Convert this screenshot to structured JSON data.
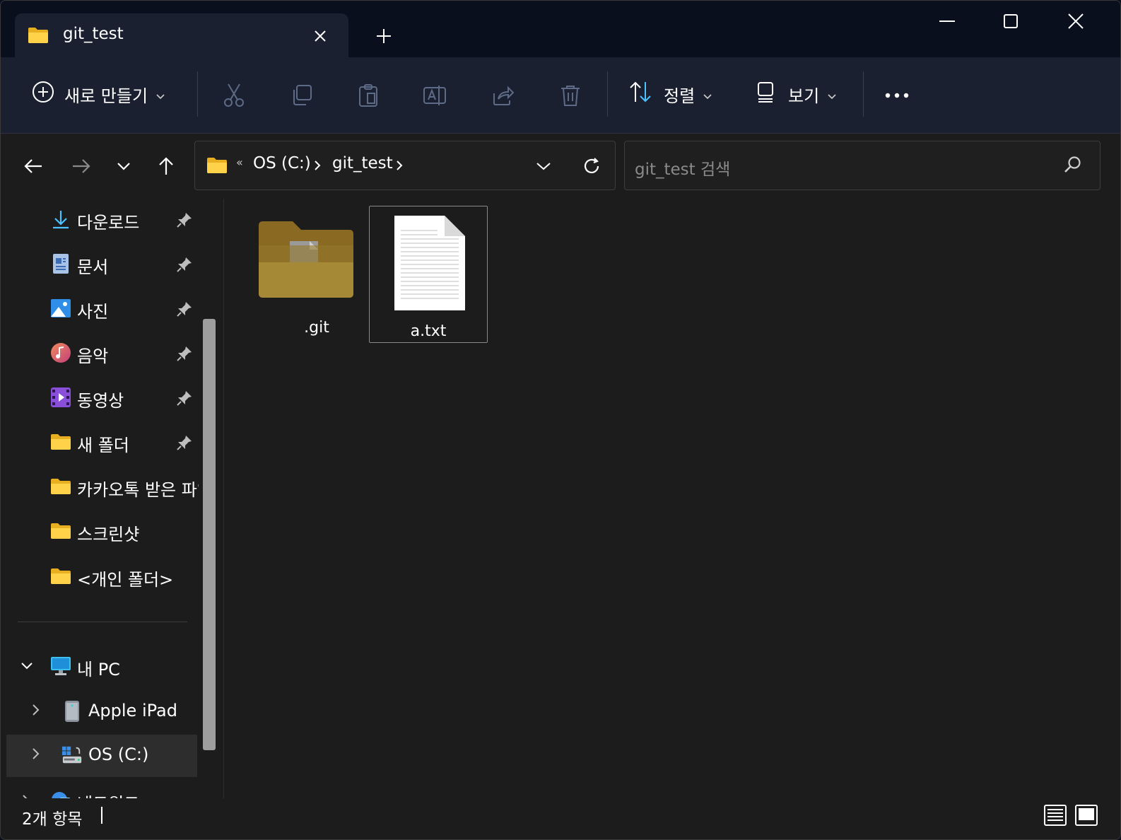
{
  "window": {
    "tab_title": "git_test",
    "new_tab_label": "+"
  },
  "toolbar": {
    "new_label": "새로 만들기",
    "sort_label": "정렬",
    "view_label": "보기"
  },
  "address": {
    "overflow": "«",
    "crumbs": [
      "OS (C:)",
      "git_test"
    ]
  },
  "search": {
    "placeholder": "git_test 검색"
  },
  "sidebar": {
    "quick_access": [
      {
        "label": "다운로드",
        "icon": "download-icon",
        "pinned": true
      },
      {
        "label": "문서",
        "icon": "documents-icon",
        "pinned": true
      },
      {
        "label": "사진",
        "icon": "pictures-icon",
        "pinned": true
      },
      {
        "label": "음악",
        "icon": "music-icon",
        "pinned": true
      },
      {
        "label": "동영상",
        "icon": "videos-icon",
        "pinned": true
      },
      {
        "label": "새 폴더",
        "icon": "folder-icon",
        "pinned": true
      },
      {
        "label": "카카오톡 받은 파일",
        "icon": "folder-icon",
        "pinned": false
      },
      {
        "label": "스크린샷",
        "icon": "folder-icon",
        "pinned": false
      },
      {
        "label": "<개인 폴더>",
        "icon": "folder-icon",
        "pinned": false
      }
    ],
    "this_pc": "내 PC",
    "devices": [
      {
        "label": "Apple iPad",
        "icon": "ipad-icon"
      },
      {
        "label": "OS (C:)",
        "icon": "drive-icon"
      }
    ],
    "network": "네트워크"
  },
  "files": [
    {
      "name": ".git",
      "type": "folder"
    },
    {
      "name": "a.txt",
      "type": "text-file"
    }
  ],
  "status": {
    "count": "2개 항목"
  },
  "colors": {
    "accent": "#4cc2ff",
    "folder": "#ffd24a",
    "window_bg": "#1c1c1c",
    "titlebar_bg": "#0a0f1e",
    "toolbar_bg": "#1b2030"
  }
}
